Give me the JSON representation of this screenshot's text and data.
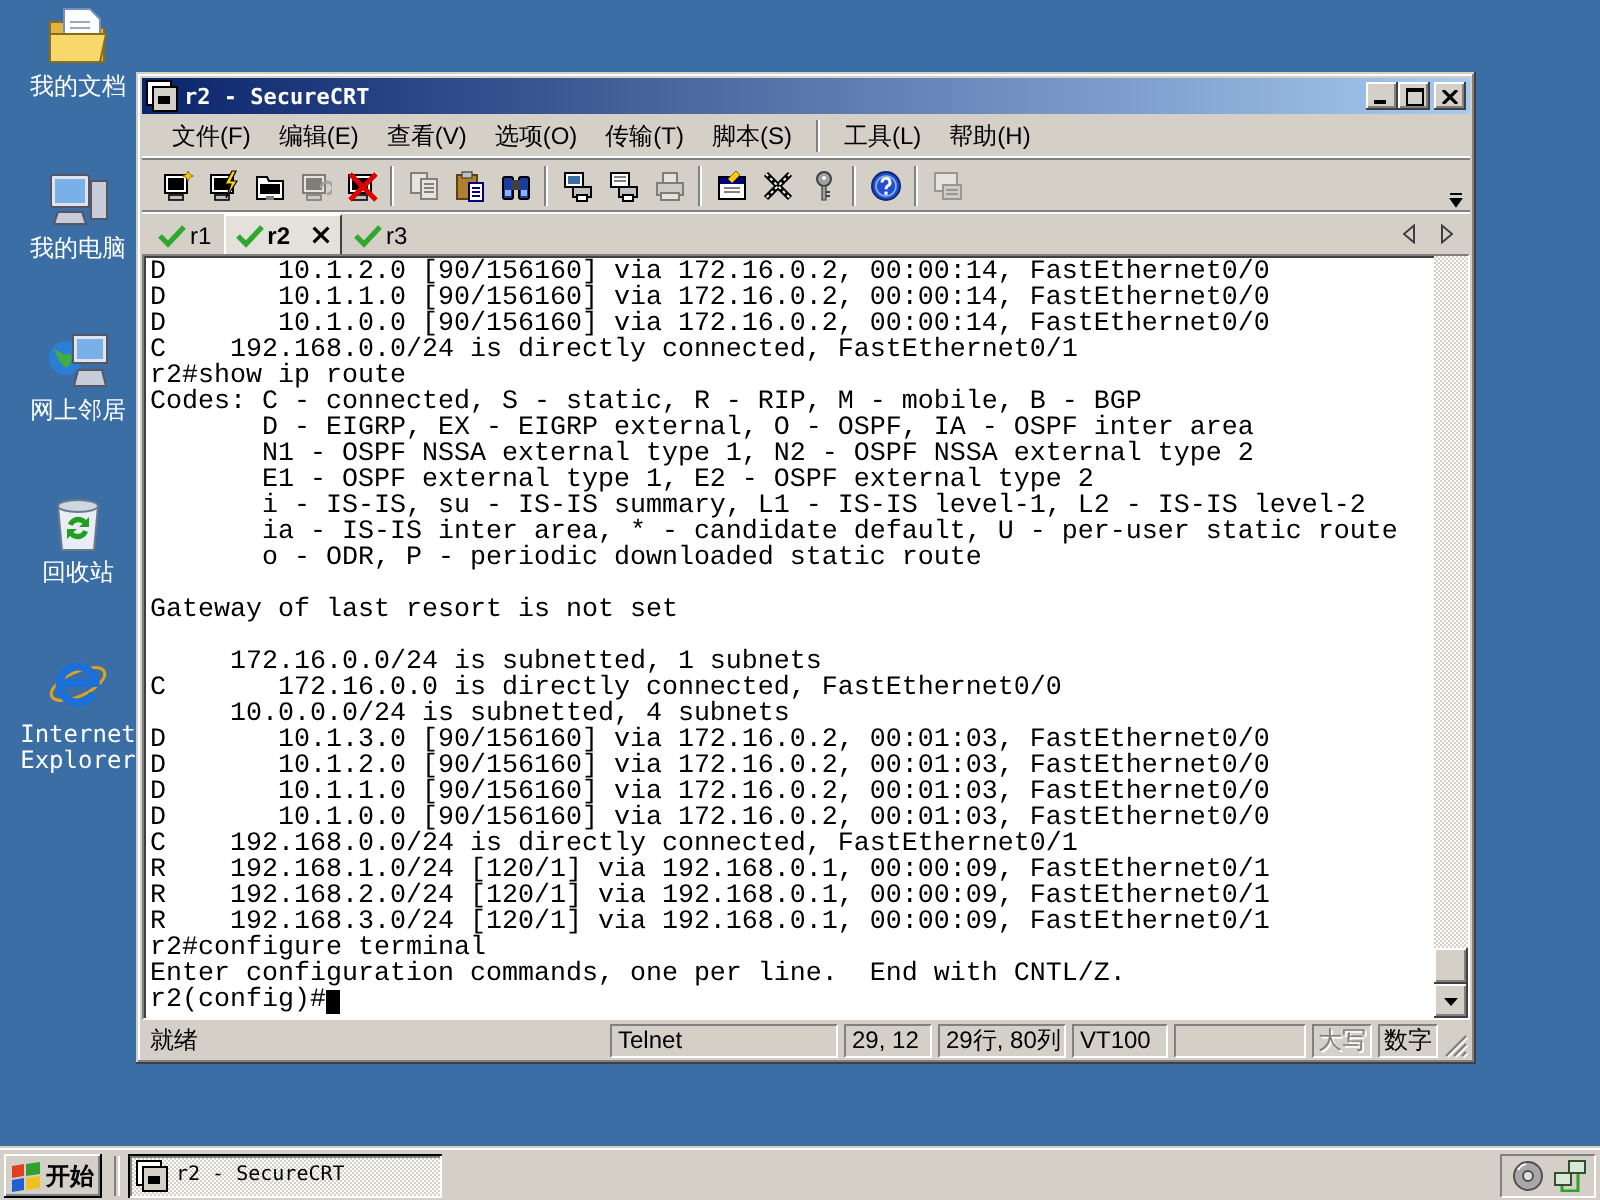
{
  "desktop_icons": [
    {
      "label": "我的文档"
    },
    {
      "label": "我的电脑"
    },
    {
      "label": "网上邻居"
    },
    {
      "label": "回收站"
    },
    {
      "label": "Internet Explorer"
    }
  ],
  "window": {
    "title": "r2 - SecureCRT",
    "active": true,
    "menu_groups": [
      [
        "文件(F)",
        "编辑(E)",
        "查看(V)",
        "选项(O)",
        "传输(T)",
        "脚本(S)"
      ],
      [
        "工具(L)",
        "帮助(H)"
      ]
    ],
    "toolbar_groups": [
      [
        {
          "disabled": false
        },
        {
          "disabled": false
        },
        {
          "disabled": false
        },
        {
          "disabled": true
        },
        {
          "disabled": false
        }
      ],
      [
        {
          "disabled": true
        },
        {
          "disabled": false
        },
        {
          "disabled": false
        }
      ],
      [
        {
          "disabled": false
        },
        {
          "disabled": false
        },
        {
          "disabled": true
        }
      ],
      [
        {
          "disabled": false
        },
        {
          "disabled": false
        },
        {
          "disabled": false
        }
      ],
      [
        {
          "disabled": false
        }
      ],
      [
        {
          "disabled": true
        }
      ]
    ],
    "tabs": [
      {
        "label": "r1",
        "selected": false,
        "connected": true
      },
      {
        "label": "r2",
        "selected": true,
        "connected": true
      },
      {
        "label": "r3",
        "selected": false,
        "connected": true
      }
    ],
    "terminal": {
      "blocks": [
        [
          "D       10.1.2.0 [90/156160] via 172.16.0.2, 00:00:14, FastEthernet0/0",
          "D       10.1.1.0 [90/156160] via 172.16.0.2, 00:00:14, FastEthernet0/0",
          "D       10.1.0.0 [90/156160] via 172.16.0.2, 00:00:14, FastEthernet0/0",
          "C    192.168.0.0/24 is directly connected, FastEthernet0/1",
          "r2#show ip route",
          "Codes: C - connected, S - static, R - RIP, M - mobile, B - BGP",
          "       D - EIGRP, EX - EIGRP external, O - OSPF, IA - OSPF inter area",
          "       N1 - OSPF NSSA external type 1, N2 - OSPF NSSA external type 2",
          "       E1 - OSPF external type 1, E2 - OSPF external type 2",
          "       i - IS-IS, su - IS-IS summary, L1 - IS-IS level-1, L2 - IS-IS level-2",
          "       ia - IS-IS inter area, * - candidate default, U - per-user static route",
          "       o - ODR, P - periodic downloaded static route"
        ],
        [
          "Gateway of last resort is not set"
        ],
        [
          "     172.16.0.0/24 is subnetted, 1 subnets",
          "C       172.16.0.0 is directly connected, FastEthernet0/0",
          "     10.0.0.0/24 is subnetted, 4 subnets",
          "D       10.1.3.0 [90/156160] via 172.16.0.2, 00:01:03, FastEthernet0/0",
          "D       10.1.2.0 [90/156160] via 172.16.0.2, 00:01:03, FastEthernet0/0",
          "D       10.1.1.0 [90/156160] via 172.16.0.2, 00:01:03, FastEthernet0/0",
          "D       10.1.0.0 [90/156160] via 172.16.0.2, 00:01:03, FastEthernet0/0",
          "C    192.168.0.0/24 is directly connected, FastEthernet0/1",
          "R    192.168.1.0/24 [120/1] via 192.168.0.1, 00:00:09, FastEthernet0/1",
          "R    192.168.2.0/24 [120/1] via 192.168.0.1, 00:00:09, FastEthernet0/1",
          "R    192.168.3.0/24 [120/1] via 192.168.0.1, 00:00:09, FastEthernet0/1",
          "r2#configure terminal",
          "Enter configuration commands, one per line.  End with CNTL/Z."
        ]
      ],
      "prompt": "r2(config)#",
      "cursor": true
    },
    "status_bar": {
      "message": "就绪",
      "panels": [
        "Telnet",
        "29, 12",
        "29行, 80列",
        "VT100"
      ],
      "indicators": [
        {
          "label": "大写",
          "on": false
        },
        {
          "label": "数字",
          "on": true
        }
      ]
    }
  },
  "taskbar": {
    "start": "开始",
    "tasks": [
      {
        "label": "r2 - SecureCRT",
        "selected": true
      }
    ]
  }
}
